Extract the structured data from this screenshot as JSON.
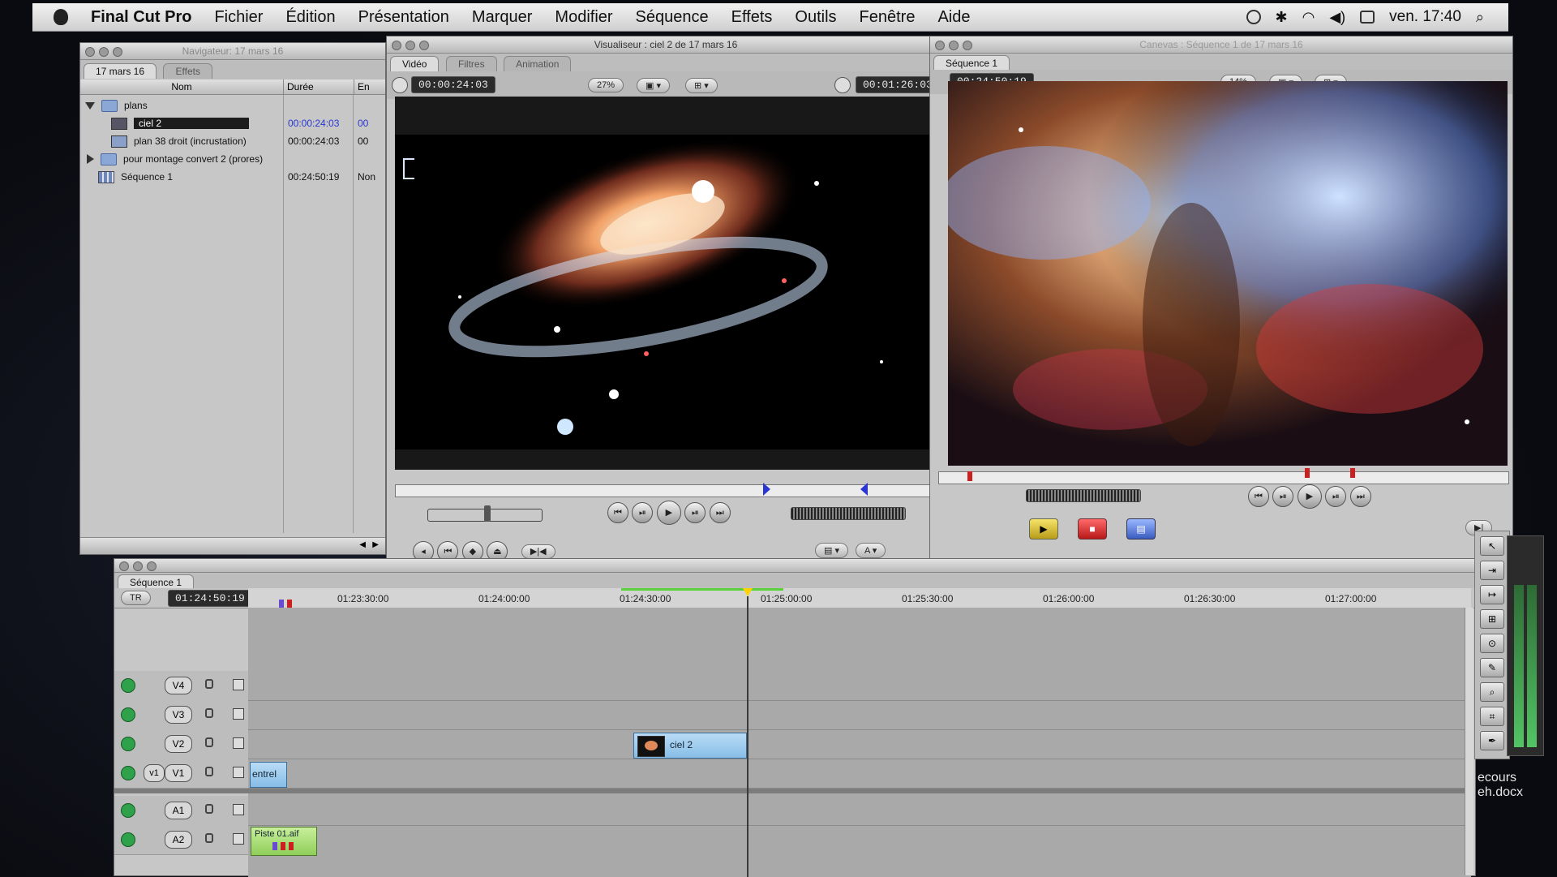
{
  "menubar": {
    "app": "Final Cut Pro",
    "items": [
      "Fichier",
      "Édition",
      "Présentation",
      "Marquer",
      "Modifier",
      "Séquence",
      "Effets",
      "Outils",
      "Fenêtre",
      "Aide"
    ],
    "clock": "ven. 17:40"
  },
  "browser": {
    "title": "Navigateur: 17 mars 16",
    "tabs": [
      "17 mars 16",
      "Effets"
    ],
    "columns": [
      "Nom",
      "Durée",
      "En"
    ],
    "rows": [
      {
        "name": "plans",
        "duration": "",
        "extra": ""
      },
      {
        "name": "ciel 2",
        "duration": "00:00:24:03",
        "extra": "00"
      },
      {
        "name": "plan 38 droit (incrustation)",
        "duration": "00:00:24:03",
        "extra": "00"
      },
      {
        "name": "pour montage convert 2 (prores)",
        "duration": "",
        "extra": ""
      },
      {
        "name": "Séquence 1",
        "duration": "00:24:50:19",
        "extra": "Non"
      }
    ]
  },
  "viewer": {
    "title": "Visualiseur : ciel 2 de 17 mars 16",
    "tabs": [
      "Vidéo",
      "Filtres",
      "Animation"
    ],
    "timecode_left": "00:00:24:03",
    "zoom": "27%",
    "timecode_right": "00:01:26:03"
  },
  "canvas": {
    "title": "Canevas : Séquence 1 de 17 mars 16",
    "tab": "Séquence 1",
    "timecode": "00:24:50:19",
    "zoom": "14%"
  },
  "timeline": {
    "tab": "Séquence 1",
    "rt_label": "TR",
    "current_timecode": "01:24:50:19",
    "ruler": [
      "01:23:30:00",
      "01:24:00:00",
      "01:24:30:00",
      "01:25:00:00",
      "01:25:30:00",
      "01:26:00:00",
      "01:26:30:00",
      "01:27:00:00"
    ],
    "video_tracks": [
      "V4",
      "V3",
      "V2",
      "V1"
    ],
    "audio_tracks": [
      "A1",
      "A2"
    ],
    "source_label": "v1",
    "clips": {
      "v2": "ciel 2",
      "v1": "entrel",
      "a2": "Piste 01.aif"
    }
  },
  "desktop": {
    "file_label_1": "ecours",
    "file_label_2": "eh.docx"
  },
  "icons": [
    "apple-icon",
    "time-machine-icon",
    "bluetooth-icon",
    "wifi-icon",
    "volume-icon",
    "battery-icon",
    "spotlight-icon"
  ],
  "colors": {
    "clip_video": "#9fcdef",
    "clip_audio": "#a6dd73",
    "track_enabled": "#2fa14a",
    "playhead": "#ffd200"
  }
}
